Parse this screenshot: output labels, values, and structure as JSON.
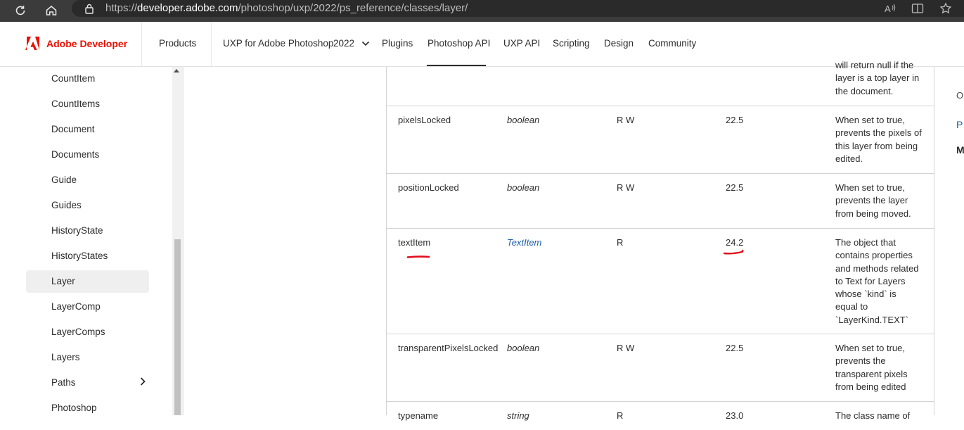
{
  "browser": {
    "url_prefix": "https://",
    "url_host": "developer.adobe.com",
    "url_path": "/photoshop/uxp/2022/ps_reference/classes/layer/",
    "icons": [
      "reload-icon",
      "home-icon",
      "lock-icon",
      "read-aloud-icon",
      "split-screen-icon",
      "favorite-star-icon"
    ]
  },
  "header": {
    "brand": "Adobe Developer",
    "nav": {
      "products": "Products",
      "uxp_for_photoshop": "UXP for Adobe Photoshop",
      "version": "2022",
      "plugins": "Plugins",
      "photoshop_api": "Photoshop API",
      "uxp_api": "UXP API",
      "scripting": "Scripting",
      "design": "Design",
      "community": "Community"
    },
    "accent_color": "#eb1000"
  },
  "sidebar": {
    "items": [
      {
        "label": "CountItem"
      },
      {
        "label": "CountItems"
      },
      {
        "label": "Document"
      },
      {
        "label": "Documents"
      },
      {
        "label": "Guide"
      },
      {
        "label": "Guides"
      },
      {
        "label": "HistoryState"
      },
      {
        "label": "HistoryStates"
      },
      {
        "label": "Layer",
        "active": true
      },
      {
        "label": "LayerComp"
      },
      {
        "label": "LayerComps"
      },
      {
        "label": "Layers"
      },
      {
        "label": "Paths"
      },
      {
        "label": "Photoshop"
      }
    ]
  },
  "table": {
    "top_partial_desc": [
      "will return null if the",
      "layer is a top layer in",
      "the document."
    ],
    "rows": [
      {
        "name": "pixelsLocked",
        "type": "boolean",
        "access": "R W",
        "min_version": "22.5",
        "desc": [
          "When set to true,",
          "prevents the pixels of",
          "this layer from being",
          "edited."
        ]
      },
      {
        "name": "positionLocked",
        "type": "boolean",
        "access": "R W",
        "min_version": "22.5",
        "desc": [
          "When set to true,",
          "prevents the layer",
          "from being moved."
        ]
      },
      {
        "name": "textItem",
        "type": "TextItem",
        "access": "R",
        "min_version": "24.2",
        "desc": [
          "The object that",
          "contains properties",
          "and methods related",
          "to Text for Layers",
          "whose `kind` is",
          "equal to",
          "`LayerKind.TEXT`"
        ]
      },
      {
        "name": "transparentPixelsLocked",
        "type": "boolean",
        "access": "R W",
        "min_version": "22.5",
        "desc": [
          "When set to true,",
          "prevents the",
          "transparent pixels",
          "from being edited"
        ]
      },
      {
        "name": "typename",
        "type": "string",
        "access": "R",
        "min_version": "23.0",
        "desc": [
          "The class name of"
        ]
      }
    ]
  },
  "rail": {
    "line1": "O",
    "line2": "P",
    "line3": "M"
  },
  "annotation_color": "#e0101c"
}
